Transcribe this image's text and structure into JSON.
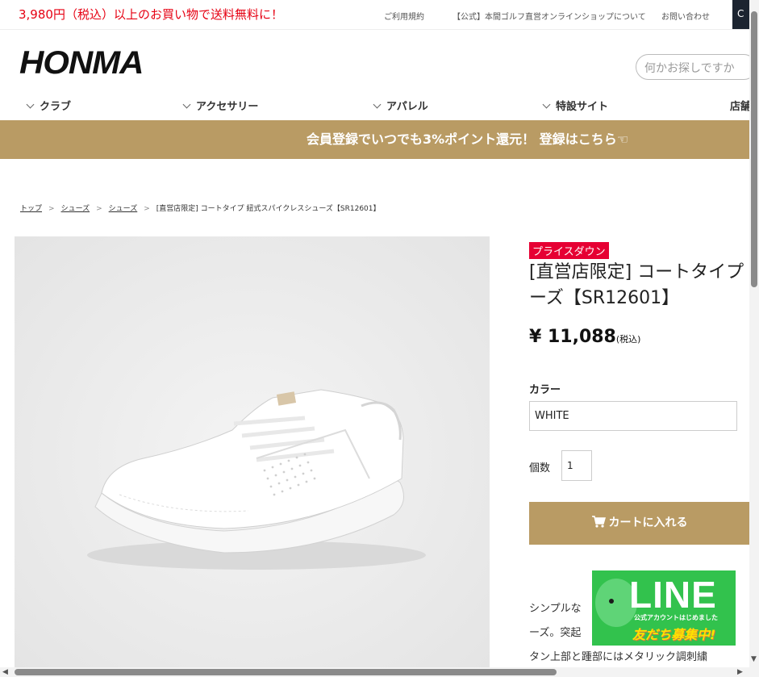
{
  "topbar": {
    "promo": "3,980円（税込）以上のお買い物で送料無料に！",
    "links": [
      "ご利用規約",
      "【公式】本間ゴルフ直営オンラインショップについて",
      "お問い合わせ"
    ],
    "dark_tab": "C"
  },
  "header": {
    "logo": "HONMA",
    "search_placeholder": "何かお探しですか"
  },
  "nav": [
    "クラブ",
    "アクセサリー",
    "アパレル",
    "特設サイト",
    "店舗"
  ],
  "banner": "会員登録でいつでも3%ポイント還元！ 登録はこちら☜",
  "breadcrumb": [
    "トップ",
    "シューズ",
    "シューズ",
    "[直営店限定] コートタイプ 紐式スパイクレスシューズ【SR12601】"
  ],
  "product": {
    "badge": "プライスダウン",
    "title_line1": "[直営店限定] コートタイプ",
    "title_line2": "ーズ【SR12601】",
    "price": "¥ 11,088",
    "tax": "(税込)",
    "color_label": "カラー",
    "color_value": "WHITE",
    "qty_label": "個数",
    "qty_value": "1",
    "cart_button": "カートに入れる",
    "desc_lines": [
      "シンプルな",
      "ーズ。突起",
      "タン上部と踵部にはメタリック調刺繍"
    ]
  },
  "line_badge": {
    "word": "LINE",
    "sub": "公式アカウントはじめました",
    "cta": "友だち募集中!"
  },
  "colors": {
    "accent": "#b99b64",
    "promo_red": "#e60012",
    "line_green": "#32c24d"
  }
}
